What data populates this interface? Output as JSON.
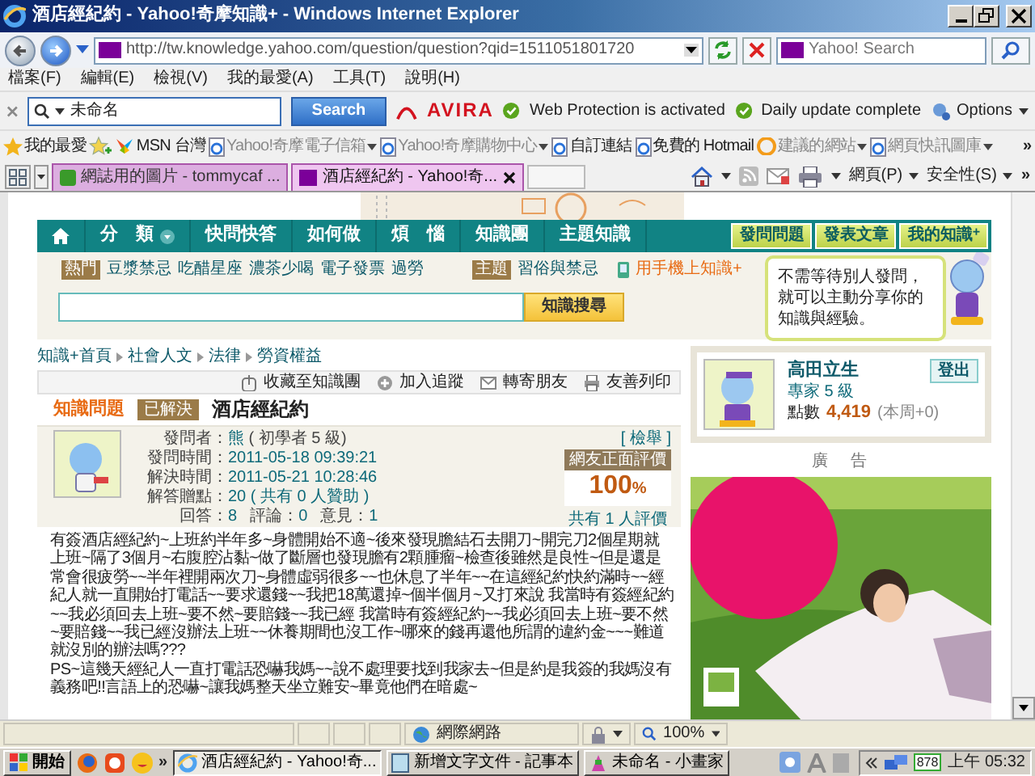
{
  "window": {
    "title": "酒店經紀約 - Yahoo!奇摩知識+ - Windows Internet Explorer"
  },
  "address_bar": {
    "url": "http://tw.knowledge.yahoo.com/question/question?qid=1511051801720",
    "search_placeholder": "Yahoo! Search"
  },
  "menu": [
    "檔案(F)",
    "編輯(E)",
    "檢視(V)",
    "我的最愛(A)",
    "工具(T)",
    "說明(H)"
  ],
  "avira_toolbar": {
    "search_value": "未命名",
    "search_button": "Search",
    "logo": "AVIRA",
    "statuses": [
      "Web Protection is activated",
      "Daily update complete"
    ],
    "options": "Options"
  },
  "favorites_bar": {
    "label": "我的最愛",
    "more": "»",
    "links": [
      {
        "label": "MSN 台灣",
        "dropdown": false,
        "dimmed": false
      },
      {
        "label": "Yahoo!奇摩電子信箱",
        "dropdown": true,
        "dimmed": true
      },
      {
        "label": "Yahoo!奇摩購物中心",
        "dropdown": true,
        "dimmed": true
      },
      {
        "label": "自訂連結",
        "dropdown": false,
        "dimmed": false
      },
      {
        "label": "免費的 Hotmail",
        "dropdown": false,
        "dimmed": false
      },
      {
        "label": "建議的網站",
        "dropdown": true,
        "dimmed": true
      },
      {
        "label": "網頁快訊圖庫",
        "dropdown": true,
        "dimmed": true
      }
    ]
  },
  "tabs": [
    {
      "label": "網誌用的圖片 - tommycaf ...",
      "selected": false
    },
    {
      "label": "酒店經紀約 - Yahoo!奇...",
      "selected": true
    }
  ],
  "command_bar": {
    "menus": [
      "網頁(P)",
      "安全性(S)"
    ],
    "more": "»"
  },
  "site_nav": {
    "items": [
      "分　類",
      "快問快答",
      "如何做",
      "煩　惱",
      "知識團",
      "主題知識"
    ],
    "actions": [
      "發問問題",
      "發表文章",
      "我的知識$^{+}$"
    ]
  },
  "hot": {
    "tag": "熱門",
    "links": [
      "豆漿禁忌",
      "吃醋星座",
      "濃茶少喝",
      "電子發票",
      "過勞"
    ]
  },
  "topic": {
    "tag": "主題",
    "links": [
      "習俗與禁忌"
    ]
  },
  "mobile_link": "用手機上知識+",
  "search_button": "知識搜尋",
  "tip": "不需等待別人發問，就可以主動分享你的知識與經驗。",
  "breadcrumb": [
    "知識+首頁",
    "社會人文",
    "法律",
    "勞資權益"
  ],
  "question_tools": [
    "收藏至知識團",
    "加入追蹤",
    "轉寄朋友",
    "友善列印"
  ],
  "question": {
    "section": "知識問題",
    "status": "已解決",
    "title": "酒店經紀約",
    "info_rows": [
      {
        "items": [
          {
            "label": "發問者：",
            "value": "熊",
            "note": "( 初學者 5 級)"
          }
        ]
      },
      {
        "items": [
          {
            "label": "發問時間：",
            "value": "2011-05-18 09:39:21"
          }
        ]
      },
      {
        "items": [
          {
            "label": "解決時間：",
            "value": "2011-05-21 10:28:46"
          }
        ]
      },
      {
        "items": [
          {
            "label": "解答贈點：",
            "value": "20",
            "note": "( 共有 0 人贊助 )"
          }
        ]
      },
      {
        "items": [
          {
            "label": "回答：",
            "value": "8"
          },
          {
            "label": "評論：",
            "value": "0"
          },
          {
            "label": "意見：",
            "value": "1"
          }
        ]
      }
    ],
    "rating": {
      "report": "[ 檢舉 ]",
      "label": "網友正面評價",
      "value": "100",
      "unit": "%",
      "count": "共有 1 人評價"
    },
    "body": [
      "有簽酒店經紀約~上班約半年多~身體開始不適~後來發現膽結石去開刀~開完刀2個星期就上班~隔了3個月~右腹腔沾黏~做了斷層也發現膽有2顆腫瘤~檢查後雖然是良性~但是還是常會很疲勞~~半年裡開兩次刀~身體虛弱很多~~也休息了半年~~在這經紀約快約滿時~~經紀人就一直開始打電話~~要求還錢~~我把18萬還掉~個半個月~又打來說 我當時有簽經紀約~~我必須回去上班~要不然~要賠錢~~我已經 我當時有簽經紀約~~我必須回去上班~要不然~要賠錢~~我已經沒辦法上班~~休養期間也沒工作~哪來的錢再還他所謂的違約金~~~難道就沒別的辦法嗎???",
      "PS~這幾天經紀人一直打電話恐嚇我媽~~說不處理要找到我家去~但是約是我簽的我媽沒有義務吧!!言語上的恐嚇~讓我媽整天坐立難安~畢竟他們在暗處~"
    ]
  },
  "user_card": {
    "name": "高田立生",
    "logout": "登出",
    "level": "專家 5 級",
    "points_label": "點數",
    "points": "4,419",
    "weekly": "(本周+0)"
  },
  "ad": {
    "label": "廣　告",
    "kind": "picture"
  },
  "status_bar": {
    "zone": "網際網路",
    "zoom": "100%"
  },
  "taskbar": {
    "start": "開始",
    "more": "»",
    "tasks": [
      {
        "label": "酒店經紀約 - Yahoo!奇...",
        "selected": true
      },
      {
        "label": "新增文字文件 - 記事本",
        "selected": false
      },
      {
        "label": "未命名 - 小畫家",
        "selected": false
      }
    ],
    "tray_badge": "878",
    "clock": "上午 05:32"
  }
}
